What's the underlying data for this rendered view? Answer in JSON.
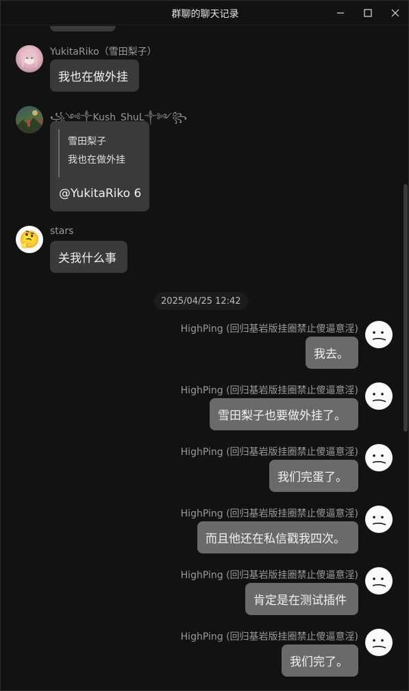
{
  "window": {
    "title": "群聊的聊天记录"
  },
  "messages_left": [
    {
      "sender": "YukitaRiko（雪田梨子）",
      "text": "我也在做外挂"
    },
    {
      "sender": "꧁༺༒Kush_ShuL༒༻꧂",
      "quote_author": "雪田梨子",
      "quote_text": "我也在做外挂",
      "text": "@YukitaRiko 6"
    },
    {
      "sender": "stars",
      "text": "关我什么事",
      "avatar_emoji": "🤔"
    }
  ],
  "timestamp": "2025/04/25 12:42",
  "messages_right": [
    {
      "sender": "HighPing (回归基岩版挂圈禁止傻逼意淫)",
      "text": "我去。"
    },
    {
      "sender": "HighPing (回归基岩版挂圈禁止傻逼意淫)",
      "text": "雪田梨子也要做外挂了。"
    },
    {
      "sender": "HighPing (回归基岩版挂圈禁止傻逼意淫)",
      "text": "我们完蛋了。"
    },
    {
      "sender": "HighPing (回归基岩版挂圈禁止傻逼意淫)",
      "text": "而且他还在私信戳我四次。"
    },
    {
      "sender": "HighPing (回归基岩版挂圈禁止傻逼意淫)",
      "text": "肯定是在测试插件"
    },
    {
      "sender": "HighPing (回归基岩版挂圈禁止傻逼意淫)",
      "text": "我们完了。"
    }
  ],
  "colors": {
    "background": "#121212",
    "bubble_other": "#3a3a3a",
    "bubble_mine": "#6a6a6a",
    "name_text": "#9a9a9a"
  }
}
